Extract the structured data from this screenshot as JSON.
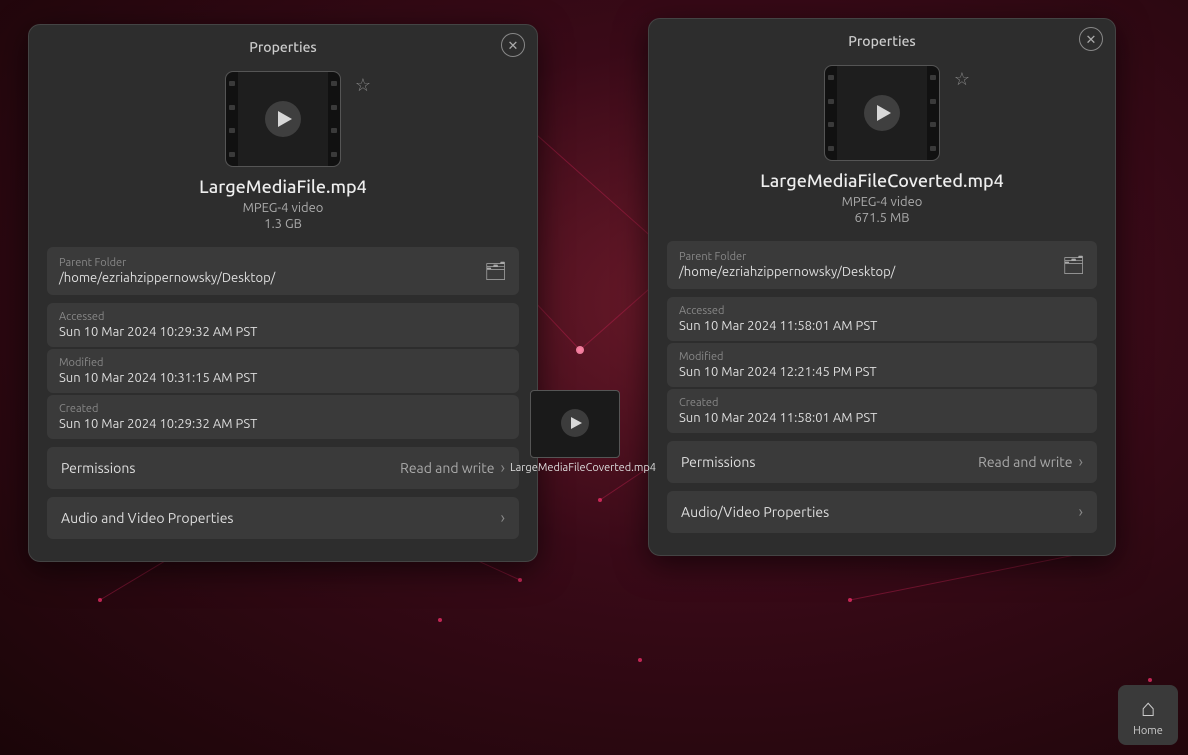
{
  "background": {
    "color": "#3a0a18"
  },
  "home_button": {
    "label": "Home",
    "icon": "🏠"
  },
  "dialog1": {
    "title": "Properties",
    "close_label": "✕",
    "file": {
      "name": "LargeMediaFile.mp4",
      "type": "MPEG-4 video",
      "size": "1.3 GB"
    },
    "parent_folder": {
      "label": "Parent Folder",
      "value": "/home/ezriahzippernowsky/Desktop/"
    },
    "accessed": {
      "label": "Accessed",
      "value": "Sun 10 Mar 2024 10:29:32 AM PST"
    },
    "modified": {
      "label": "Modified",
      "value": "Sun 10 Mar 2024 10:31:15 AM PST"
    },
    "created": {
      "label": "Created",
      "value": "Sun 10 Mar 2024 10:29:32 AM PST"
    },
    "permissions": {
      "label": "Permissions",
      "value": "Read and write"
    },
    "audio_video": {
      "label": "Audio and Video Properties"
    }
  },
  "dialog2": {
    "title": "Properties",
    "close_label": "✕",
    "file": {
      "name": "LargeMediaFileCoverted.mp4",
      "type": "MPEG-4 video",
      "size": "671.5 MB"
    },
    "parent_folder": {
      "label": "Parent Folder",
      "value": "/home/ezriahzippernowsky/Desktop/"
    },
    "accessed": {
      "label": "Accessed",
      "value": "Sun 10 Mar 2024 11:58:01 AM PST"
    },
    "modified": {
      "label": "Modified",
      "value": "Sun 10 Mar 2024 12:21:45 PM PST"
    },
    "created": {
      "label": "Created",
      "value": "Sun 10 Mar 2024 11:58:01 AM PST"
    },
    "permissions": {
      "label": "Permissions",
      "value": "Read and write"
    },
    "audio_video": {
      "label": "Audio/Video Properties"
    }
  },
  "bg_video": {
    "label": "LargeMediaFileCoverted.mp4"
  }
}
